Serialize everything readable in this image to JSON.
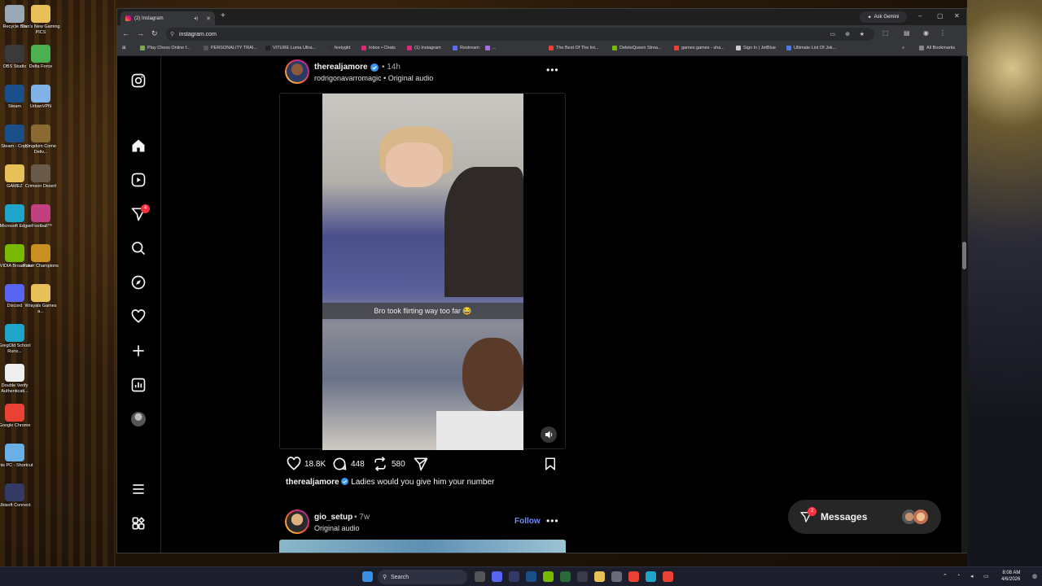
{
  "desktop": {
    "icons": [
      {
        "label": "Recycle Bin",
        "color": "#9aa7b5"
      },
      {
        "label": "Dan's New Gaming PICS",
        "color": "#e8c05a"
      },
      {
        "label": "OBS Studio",
        "color": "#3a3a3a"
      },
      {
        "label": "Delta Force",
        "color": "#4caf50"
      },
      {
        "label": "Steam",
        "color": "#1b4f8a"
      },
      {
        "label": "UrbanVPN",
        "color": "#7fb3e8"
      },
      {
        "label": "Steam - Copy",
        "color": "#1b4f8a"
      },
      {
        "label": "Kingdom Come Deliv...",
        "color": "#8a6a30"
      },
      {
        "label": "GAMEZ",
        "color": "#e8c05a"
      },
      {
        "label": "Crimson Desert",
        "color": "#6a5a4a"
      },
      {
        "label": "Microsoft Edge",
        "color": "#1fa5c9"
      },
      {
        "label": "eFootball™",
        "color": "#c04080"
      },
      {
        "label": "NVIDIA Broadcast",
        "color": "#76b900"
      },
      {
        "label": "Poker Champions",
        "color": "#c89020"
      },
      {
        "label": "Discord",
        "color": "#5865f2"
      },
      {
        "label": "Wrayals Games a...",
        "color": "#e8c05a"
      },
      {
        "label": "GregOld School Runs...",
        "color": "#1fa5c9"
      },
      {
        "label": "Double Verify Authenticati...",
        "color": "#eeeeee"
      },
      {
        "label": "Google Chrome",
        "color": "#e94235"
      },
      {
        "label": "This PC - Shortcut",
        "color": "#6ab0e8"
      },
      {
        "label": "Ubisoft Connect",
        "color": "#333a66"
      }
    ]
  },
  "browser": {
    "tab_title": "(2) Instagram",
    "ask_gemini": "Ask Gemini",
    "url": "instagram.com",
    "bookmarks": [
      {
        "label": "Play Chess Online f...",
        "color": "#7fa650"
      },
      {
        "label": "PERSONALITY TRAI...",
        "color": "#555555"
      },
      {
        "label": "VITURE Luma Ultra...",
        "color": "#222222"
      },
      {
        "label": "feetygkt",
        "color": "#333333"
      },
      {
        "label": "Inbox • Chats",
        "color": "#d62976"
      },
      {
        "label": "(1) Instagram",
        "color": "#d62976"
      },
      {
        "label": "Restream",
        "color": "#5b6cf0"
      },
      {
        "label": "...",
        "color": "#a070e0"
      },
      {
        "label": "The Best Of The Int...",
        "color": "#e94235"
      },
      {
        "label": "DeleteQueen Strea...",
        "color": "#76b900"
      },
      {
        "label": "games games - sha...",
        "color": "#e94235"
      },
      {
        "label": "Sign In | JetBlue",
        "color": "#cccccc"
      },
      {
        "label": "Ultimate List Of Jok...",
        "color": "#4a7ae8"
      }
    ],
    "all_bookmarks": "All Bookmarks"
  },
  "instagram": {
    "notification_count": "4",
    "post": {
      "username": "therealjamore",
      "time": "14h",
      "audio": "rodrigonavarromagic • Original audio",
      "overlay_text": "Bro took flirting way too far 😂",
      "likes": "18.8K",
      "comments": "448",
      "reposts": "580",
      "caption_user": "therealjamore",
      "caption_text": "Ladies would you give him your number"
    },
    "next_post": {
      "username": "gio_setup",
      "time": "7w",
      "audio": "Original audio",
      "follow": "Follow"
    },
    "messages": {
      "label": "Messages",
      "count": "2"
    }
  },
  "taskbar": {
    "search_placeholder": "Search",
    "time": "8:08 AM",
    "date": "4/6/2026"
  }
}
